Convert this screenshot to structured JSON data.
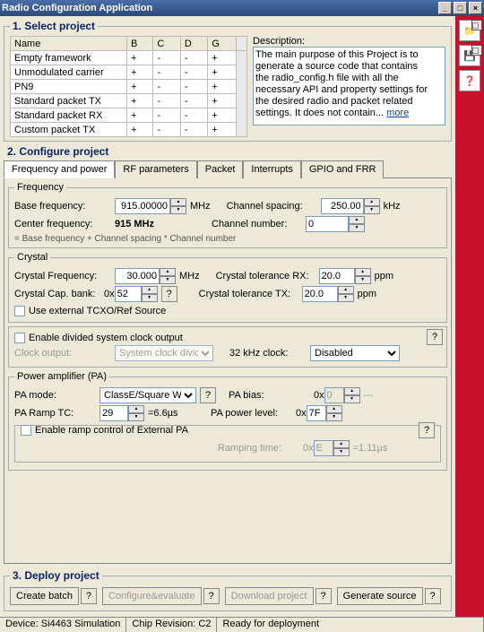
{
  "title": "Radio Configuration Application",
  "winbuttons": {
    "min": "_",
    "max": "□",
    "close": "×"
  },
  "rightIcons": [
    "📁",
    "💾",
    "❓"
  ],
  "sideBoxes": [
    "□",
    "□"
  ],
  "section1": {
    "title": "1. Select project",
    "headers": [
      "Name",
      "B",
      "C",
      "D",
      "G"
    ],
    "rows": [
      {
        "name": "Empty framework",
        "b": "+",
        "c": "-",
        "d": "-",
        "g": "+"
      },
      {
        "name": "Unmodulated carrier",
        "b": "+",
        "c": "-",
        "d": "-",
        "g": "+"
      },
      {
        "name": "PN9",
        "b": "+",
        "c": "-",
        "d": "-",
        "g": "+"
      },
      {
        "name": "Standard packet TX",
        "b": "+",
        "c": "-",
        "d": "-",
        "g": "+"
      },
      {
        "name": "Standard packet RX",
        "b": "+",
        "c": "-",
        "d": "-",
        "g": "+"
      },
      {
        "name": "Custom packet TX",
        "b": "+",
        "c": "-",
        "d": "-",
        "g": "+"
      }
    ],
    "descLabel": "Description:",
    "descText": "The main purpose of this Project is to generate a source code that contains the radio_config.h file with all the necessary API and property settings for the desired radio and packet related settings. It does not contain... ",
    "moreLabel": "more"
  },
  "section2": {
    "title": "2. Configure project",
    "tabs": [
      "Frequency and power",
      "RF parameters",
      "Packet",
      "Interrupts",
      "GPIO and FRR"
    ]
  },
  "freq": {
    "legend": "Frequency",
    "baseLabel": "Base frequency:",
    "base": "915.00000",
    "baseUnit": "MHz",
    "spacingLabel": "Channel spacing:",
    "spacing": "250.00",
    "spacingUnit": "kHz",
    "centerLabel": "Center frequency:",
    "center": "915 MHz",
    "chanLabel": "Channel number:",
    "chan": "0",
    "note": "= Base frequency + Channel spacing * Channel number"
  },
  "crystal": {
    "legend": "Crystal",
    "freqLabel": "Crystal Frequency:",
    "freq": "30.000",
    "freqUnit": "MHz",
    "tolRxLabel": "Crystal tolerance RX:",
    "tolRx": "20.0",
    "tolRxUnit": "ppm",
    "capLabel": "Crystal Cap. bank:",
    "capPrefix": "0x",
    "cap": "52",
    "helpBtn": "?",
    "tolTxLabel": "Crystal tolerance TX:",
    "tolTx": "20.0",
    "tolTxUnit": "ppm",
    "extLabel": "Use external TCXO/Ref Source"
  },
  "clock": {
    "enableLabel": "Enable divided system clock output",
    "outLabel": "Clock output:",
    "out": "System clock divid",
    "khzLabel": "32 kHz clock:",
    "khz": "Disabled",
    "helpBtn": "?"
  },
  "pa": {
    "legend": "Power amplifier (PA)",
    "modeLabel": "PA mode:",
    "mode": "ClassE/Square W",
    "helpBtn": "?",
    "biasLabel": "PA bias:",
    "biasPrefix": "0x",
    "bias": "0",
    "biasUnit": "---",
    "rampLabel": "PA Ramp TC:",
    "ramp": "29",
    "rampUnit": "=6.6µs",
    "powerLabel": "PA power level:",
    "powerPrefix": "0x",
    "power": "7F",
    "extLabel": "Enable ramp control of External PA",
    "rampingLabel": "Ramping time:",
    "rampingPrefix": "0x",
    "ramping": "E",
    "rampingUnit": "=1.11µs"
  },
  "section3": {
    "title": "3. Deploy project",
    "createBatch": "Create batch",
    "cfgEval": "Configure&evaluate",
    "download": "Download project",
    "generate": "Generate source",
    "help": "?"
  },
  "status": {
    "device": "Device: Si4463  Simulation",
    "chip": "Chip Revision: C2",
    "ready": "Ready for deployment"
  }
}
